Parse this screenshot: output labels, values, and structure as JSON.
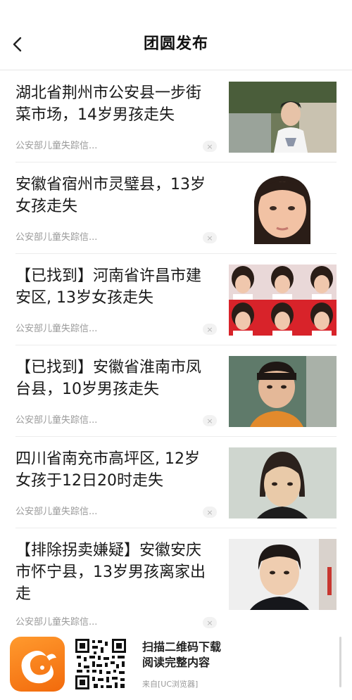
{
  "header": {
    "title": "团圆发布",
    "back_icon": "chevron-left-icon"
  },
  "items": [
    {
      "headline": "湖北省荆州市公安县一步街菜市场，14岁男孩走失",
      "source": "公安部儿童失踪信...",
      "close": "×"
    },
    {
      "headline": "安徽省宿州市灵璧县，13岁女孩走失",
      "source": "公安部儿童失踪信...",
      "close": "×"
    },
    {
      "headline": "【已找到】河南省许昌市建安区, 13岁女孩走失",
      "source": "公安部儿童失踪信...",
      "close": "×"
    },
    {
      "headline": "【已找到】安徽省淮南市凤台县，10岁男孩走失",
      "source": "公安部儿童失踪信...",
      "close": "×"
    },
    {
      "headline": "四川省南充市高坪区, 12岁女孩于12日20时走失",
      "source": "公安部儿童失踪信...",
      "close": "×"
    },
    {
      "headline": "【排除拐卖嫌疑】安徽安庆市怀宁县，13岁男孩离家出走",
      "source": "公安部儿童失踪信...",
      "close": "×"
    }
  ],
  "footer": {
    "cta_line1": "扫描二维码下载",
    "cta_line2": "阅读完整内容",
    "from": "来自[UC浏览器]",
    "logo_icon": "uc-browser-squirrel-icon",
    "qr_icon": "qr-code-icon"
  },
  "colors": {
    "brand_orange": "#f2780f",
    "text": "#1a1a1a",
    "meta": "#9a9a9a"
  }
}
